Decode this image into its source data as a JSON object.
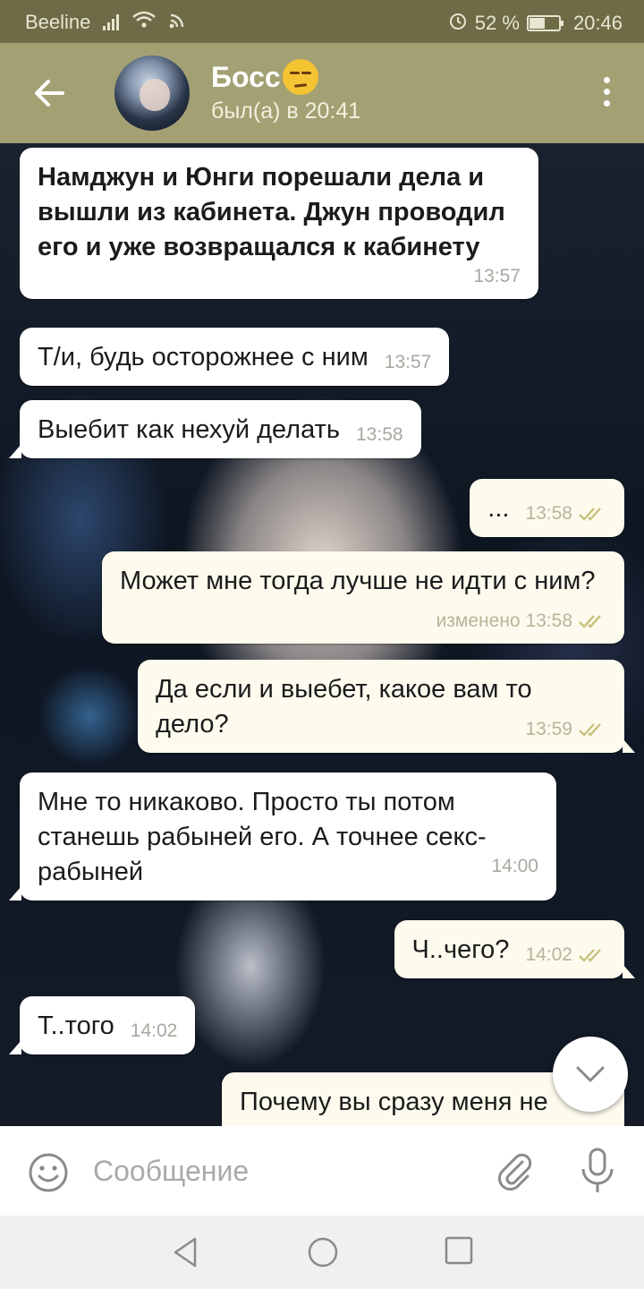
{
  "status_bar": {
    "carrier": "Beeline",
    "battery": "52 %",
    "battery_level": 0.52,
    "time": "20:46"
  },
  "header": {
    "title": "Босс",
    "status": "был(а) в 20:41"
  },
  "messages": [
    {
      "direction": "in",
      "text": "Намджун и Юнги порешали дела и вышли из кабинета. Джун проводил его и уже возвращался к кабинету",
      "time": "13:57",
      "bold": true
    },
    {
      "direction": "in",
      "text": "Т/и, будь осторожнее с ним",
      "time": "13:57"
    },
    {
      "direction": "in",
      "text": "Выебит как нехуй делать",
      "time": "13:58"
    },
    {
      "direction": "out",
      "text": "...",
      "time": "13:58",
      "read": true
    },
    {
      "direction": "out",
      "text": "Может мне тогда лучше не идти с ним?",
      "time": "изменено 13:58",
      "read": true
    },
    {
      "direction": "out",
      "text": "Да если и выебет, какое вам то дело?",
      "time": "13:59",
      "read": true
    },
    {
      "direction": "in",
      "text": "Мне то никаково. Просто ты потом станешь рабыней его. А точнее секс-рабыней",
      "time": "14:00"
    },
    {
      "direction": "out",
      "text": "Ч..чего?",
      "time": "14:02",
      "read": true
    },
    {
      "direction": "in",
      "text": "Т..того",
      "time": "14:02"
    },
    {
      "direction": "out",
      "text": "Почему вы сразу меня не",
      "time": ""
    }
  ],
  "composer": {
    "placeholder": "Сообщение"
  },
  "colors": {
    "status_bar": "#6e6b47",
    "header": "#a3a174",
    "incoming_bubble": "#ffffff",
    "outgoing_bubble": "#fdfbee",
    "read_check": "#c9c07a"
  },
  "icons": [
    "back-arrow-icon",
    "more-vert-icon",
    "emoji-icon",
    "attach-icon",
    "mic-icon",
    "chevron-down-icon",
    "nav-back-icon",
    "nav-home-icon",
    "nav-recents-icon"
  ]
}
